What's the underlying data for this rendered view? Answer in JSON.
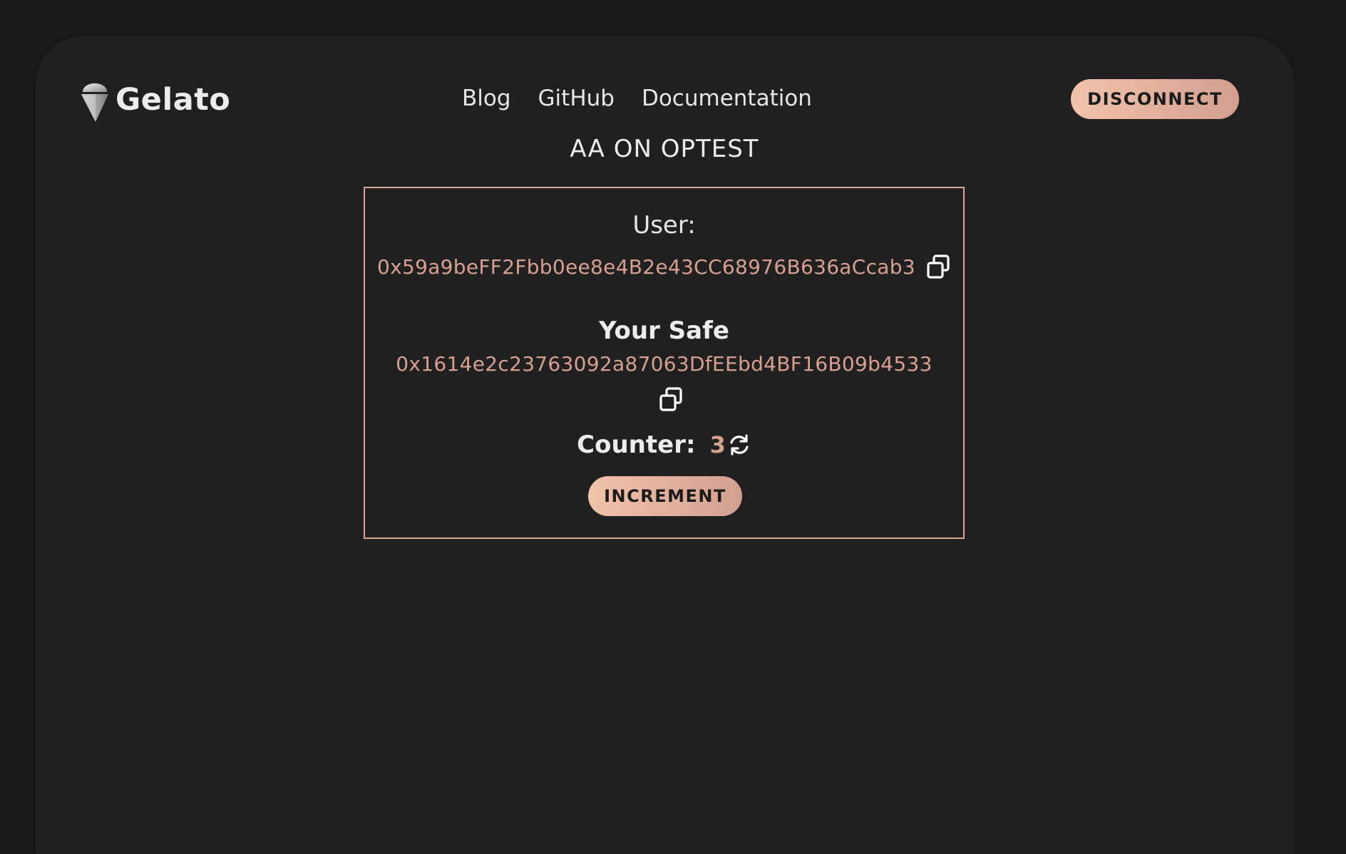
{
  "brand": {
    "name": "Gelato"
  },
  "nav": {
    "items": [
      "Blog",
      "GitHub",
      "Documentation"
    ]
  },
  "header": {
    "disconnect_label": "DISCONNECT"
  },
  "app": {
    "title": "AA ON OPTEST"
  },
  "card": {
    "user_label": "User:",
    "user_address": "0x59a9beFF2Fbb0ee8e4B2e43CC68976B636aCcab3",
    "safe_label": "Your Safe",
    "safe_address": "0x1614e2c23763092a87063DfEEbd4BF16B09b4533",
    "counter_label": "Counter:",
    "counter_value": "3",
    "increment_label": "INCREMENT"
  },
  "icons": {
    "logo": "ice-cream-cone-icon",
    "copy": "copy-icon",
    "refresh": "refresh-icon"
  },
  "colors": {
    "accent_start": "#f1c3ab",
    "accent_end": "#d39f8e",
    "address": "#d8a090",
    "panel": "#202020",
    "background": "#1a1a1a"
  }
}
